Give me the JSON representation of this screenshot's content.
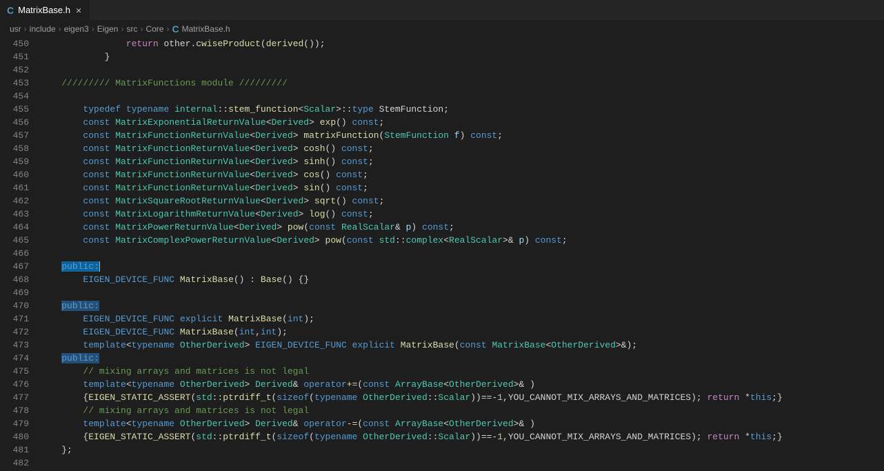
{
  "tab": {
    "icon": "C",
    "title": "MatrixBase.h",
    "close": "×"
  },
  "breadcrumbs": [
    "usr",
    "include",
    "eigen3",
    "Eigen",
    "src",
    "Core",
    "MatrixBase.h"
  ],
  "breadcrumb_file_icon": "C",
  "breadcrumb_sep": "›",
  "line_start": 450,
  "line_end": 482,
  "code": {
    "l450": {
      "indent": "                ",
      "return": "return",
      "other": "other",
      "dot": ".",
      "fn": "cwiseProduct",
      "p1": "(",
      "fn2": "derived",
      "p2": "())",
      "semi": ";"
    },
    "l451": {
      "indent": "            ",
      "brace": "}"
    },
    "l453": {
      "indent": "    ",
      "cm": "///////// MatrixFunctions module /////////"
    },
    "l455": {
      "indent": "        ",
      "typedef": "typedef",
      "typename": "typename",
      "ns": "internal",
      "cc": "::",
      "sf": "stem_function",
      "lt": "<",
      "ty": "Scalar",
      "gt": ">::",
      "type": "type",
      "sfn": " StemFunction;"
    },
    "l456": {
      "indent": "        ",
      "const": "const",
      "ty": "MatrixExponentialReturnValue",
      "lt": "<",
      "dv": "Derived",
      "gt": ">",
      "fn": "exp",
      "pp": "()",
      "c2": "const",
      "semi": ";"
    },
    "l457": {
      "indent": "        ",
      "const": "const",
      "ty": "MatrixFunctionReturnValue",
      "lt": "<",
      "dv": "Derived",
      "gt": ">",
      "fn": "matrixFunction",
      "p1": "(",
      "pty": "StemFunction",
      "pm": "f",
      "p2": ")",
      "c2": "const",
      "semi": ";"
    },
    "l458": {
      "indent": "        ",
      "const": "const",
      "ty": "MatrixFunctionReturnValue",
      "lt": "<",
      "dv": "Derived",
      "gt": ">",
      "fn": "cosh",
      "pp": "()",
      "c2": "const",
      "semi": ";"
    },
    "l459": {
      "indent": "        ",
      "const": "const",
      "ty": "MatrixFunctionReturnValue",
      "lt": "<",
      "dv": "Derived",
      "gt": ">",
      "fn": "sinh",
      "pp": "()",
      "c2": "const",
      "semi": ";"
    },
    "l460": {
      "indent": "        ",
      "const": "const",
      "ty": "MatrixFunctionReturnValue",
      "lt": "<",
      "dv": "Derived",
      "gt": ">",
      "fn": "cos",
      "pp": "()",
      "c2": "const",
      "semi": ";"
    },
    "l461": {
      "indent": "        ",
      "const": "const",
      "ty": "MatrixFunctionReturnValue",
      "lt": "<",
      "dv": "Derived",
      "gt": ">",
      "fn": "sin",
      "pp": "()",
      "c2": "const",
      "semi": ";"
    },
    "l462": {
      "indent": "        ",
      "const": "const",
      "ty": "MatrixSquareRootReturnValue",
      "lt": "<",
      "dv": "Derived",
      "gt": ">",
      "fn": "sqrt",
      "pp": "()",
      "c2": "const",
      "semi": ";"
    },
    "l463": {
      "indent": "        ",
      "const": "const",
      "ty": "MatrixLogarithmReturnValue",
      "lt": "<",
      "dv": "Derived",
      "gt": ">",
      "fn": "log",
      "pp": "()",
      "c2": "const",
      "semi": ";"
    },
    "l464": {
      "indent": "        ",
      "const": "const",
      "ty": "MatrixPowerReturnValue",
      "lt": "<",
      "dv": "Derived",
      "gt": ">",
      "fn": "pow",
      "p1": "(",
      "pc": "const",
      "pty": "RealScalar",
      "amp": "&",
      "pm": "p",
      "p2": ")",
      "c2": "const",
      "semi": ";"
    },
    "l465": {
      "indent": "        ",
      "const": "const",
      "ty": "MatrixComplexPowerReturnValue",
      "lt": "<",
      "dv": "Derived",
      "gt": ">",
      "fn": "pow",
      "p1": "(",
      "pc": "const",
      "std": "std",
      "cc": "::",
      "cx": "complex",
      "lt2": "<",
      "rs": "RealScalar",
      "gt2": ">&",
      "pm": "p",
      "p2": ")",
      "c2": "const",
      "semi": ";"
    },
    "l467": {
      "indent": "    ",
      "pub": "public:"
    },
    "l468": {
      "indent": "        ",
      "mc": "EIGEN_DEVICE_FUNC",
      "fn": "MatrixBase",
      "pp": "() :",
      "base": "Base",
      "pp2": "() {}"
    },
    "l470": {
      "indent": "    ",
      "pub": "public:"
    },
    "l471": {
      "indent": "        ",
      "mc": "EIGEN_DEVICE_FUNC",
      "ex": "explicit",
      "fn": "MatrixBase",
      "p1": "(",
      "int": "int",
      "p2": ");"
    },
    "l472": {
      "indent": "        ",
      "mc": "EIGEN_DEVICE_FUNC",
      "fn": "MatrixBase",
      "p1": "(",
      "int": "int",
      "comma": ",",
      "int2": "int",
      "p2": ");"
    },
    "l473": {
      "indent": "        ",
      "tmpl": "template",
      "lt": "<",
      "tn": "typename",
      "od": "OtherDerived",
      "gt": ">",
      "mc": "EIGEN_DEVICE_FUNC",
      "ex": "explicit",
      "fn": "MatrixBase",
      "p1": "(",
      "const": "const",
      "ty": "MatrixBase",
      "lt2": "<",
      "od2": "OtherDerived",
      "gt2": ">&",
      "p2": ");"
    },
    "l474": {
      "indent": "    ",
      "pub": "public:"
    },
    "l475": {
      "indent": "        ",
      "cm": "// mixing arrays and matrices is not legal"
    },
    "l476": {
      "indent": "        ",
      "tmpl": "template",
      "lt": "<",
      "tn": "typename",
      "od": "OtherDerived",
      "gt": ">",
      "dv": "Derived",
      "amp": "&",
      "op": "operator",
      "ope": "+=",
      "p1": "(",
      "const": "const",
      "ab": "ArrayBase",
      "lt2": "<",
      "od2": "OtherDerived",
      "gt2": ">&",
      "p2": " )"
    },
    "l477": {
      "indent": "        ",
      "brace": "{",
      "esa": "EIGEN_STATIC_ASSERT",
      "p1": "(",
      "std": "std",
      "cc": "::",
      "pd": "ptrdiff_t",
      "p2": "(",
      "so": "sizeof",
      "p3": "(",
      "tn": "typename",
      "od": "OtherDerived",
      "cc2": "::",
      "sc": "Scalar",
      "p4": "))==-",
      "num": "1",
      "comma": ",",
      "err": "YOU_CANNOT_MIX_ARRAYS_AND_MATRICES",
      "p5": ");",
      "ret": "return",
      "star": " *",
      "this": "this",
      "p6": ";}"
    },
    "l478": {
      "indent": "        ",
      "cm": "// mixing arrays and matrices is not legal"
    },
    "l479": {
      "indent": "        ",
      "tmpl": "template",
      "lt": "<",
      "tn": "typename",
      "od": "OtherDerived",
      "gt": ">",
      "dv": "Derived",
      "amp": "&",
      "op": "operator",
      "ope": "-=",
      "p1": "(",
      "const": "const",
      "ab": "ArrayBase",
      "lt2": "<",
      "od2": "OtherDerived",
      "gt2": ">&",
      "p2": " )"
    },
    "l480": {
      "indent": "        ",
      "brace": "{",
      "esa": "EIGEN_STATIC_ASSERT",
      "p1": "(",
      "std": "std",
      "cc": "::",
      "pd": "ptrdiff_t",
      "p2": "(",
      "so": "sizeof",
      "p3": "(",
      "tn": "typename",
      "od": "OtherDerived",
      "cc2": "::",
      "sc": "Scalar",
      "p4": "))==-",
      "num": "1",
      "comma": ",",
      "err": "YOU_CANNOT_MIX_ARRAYS_AND_MATRICES",
      "p5": ");",
      "ret": "return",
      "star": " *",
      "this": "this",
      "p6": ";}"
    },
    "l481": {
      "indent": "    ",
      "brace": "};"
    }
  }
}
